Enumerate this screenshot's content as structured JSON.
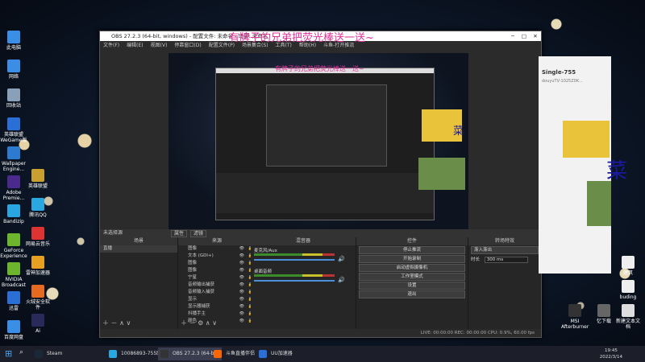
{
  "desktop_icons": [
    {
      "label": "此电脑",
      "color": "#3a8ee6"
    },
    {
      "label": "网络",
      "color": "#3a8ee6"
    },
    {
      "label": "回收站",
      "color": "#8aa0b8"
    },
    {
      "label": "英雄联盟 WeGame版",
      "color": "#2a6fd6"
    },
    {
      "label": "Wallpaper Engine...",
      "color": "#2c7bd1"
    },
    {
      "label": "Adobe Premie...",
      "color": "#4a2a8c"
    },
    {
      "label": "Bandizip",
      "color": "#2aa6e0"
    },
    {
      "label": "GeForce Experience",
      "color": "#6cb52d"
    },
    {
      "label": "NVIDIA Broadcast",
      "color": "#6cb52d"
    },
    {
      "label": "迅雷",
      "color": "#2a6fd6"
    },
    {
      "label": "百度网盘",
      "color": "#3a8ee6"
    }
  ],
  "desktop_icons_col2": [
    {
      "label": "英雄联盟",
      "color": "#c9a030"
    },
    {
      "label": "腾讯QQ",
      "color": "#2aa6e0"
    },
    {
      "label": "网易云音乐",
      "color": "#d33"
    },
    {
      "label": "雷神加速器",
      "color": "#e8a020"
    },
    {
      "label": "火绒安全软件",
      "color": "#e86a20"
    },
    {
      "label": "Ai",
      "color": "#2a2a5a"
    }
  ],
  "right_icons": [
    {
      "label": "MSI Afterburner",
      "color": "#333"
    },
    {
      "label": "忆下载",
      "color": "#666"
    },
    {
      "label": "新建文本文档",
      "color": "#ddd"
    },
    {
      "label": "建筑",
      "color": "#eee"
    },
    {
      "label": "buding",
      "color": "#eee"
    }
  ],
  "obs": {
    "title": "OBS 27.2.3 (64-bit, windows) - 配置文件: 未命名 - 场景: 未命名",
    "menu": [
      "文件(F)",
      "编辑(E)",
      "视图(V)",
      "停靠窗口(D)",
      "配置文件(P)",
      "场景集合(S)",
      "工具(T)",
      "帮助(H)",
      "斗鱼-打开推流"
    ],
    "overlay": "有牌子的兄弟把荧光棒送一送~",
    "scene_bar": "未选择源",
    "scene_bar_buttons": [
      "属性",
      "滤镜"
    ],
    "docks": {
      "scenes": {
        "title": "场景",
        "items": [
          "直播"
        ]
      },
      "sources": {
        "title": "来源",
        "items": [
          "图像",
          "文本 (GDI+)",
          "图像",
          "图像",
          "宁星",
          "音频输出捕获",
          "音频输入捕获",
          "显示",
          "显示器捕获",
          "抖播手主",
          "颜色"
        ]
      },
      "mixer": {
        "title": "混音器",
        "channels": [
          {
            "name": "麦克风/Aux"
          },
          {
            "name": "桌面音频"
          }
        ]
      },
      "controls": {
        "title": "控件",
        "buttons": [
          "停止推流",
          "开始录制",
          "启动虚拟摄像机",
          "工作室模式",
          "设置",
          "退出"
        ]
      },
      "transitions": {
        "title": "转场特效",
        "type": "渐入渐出",
        "duration_label": "时长",
        "duration": "300 ms"
      }
    },
    "status": "LIVE: 00:00:00    REC: 00:00:00    CPU: 0.9%, 60.00 fps"
  },
  "chat": {
    "title": "Single-755",
    "subtitle": "douyuTV-1025Z0K..."
  },
  "veg_text": "菜",
  "taskbar": {
    "items": [
      {
        "label": "Steam",
        "color": "#1b2838"
      },
      {
        "label": "10086893-755图...",
        "color": "#2aa6e0"
      },
      {
        "label": "OBS 27.2.3 (64-bit...",
        "color": "#333"
      },
      {
        "label": "斗鱼直播伴侣",
        "color": "#f60"
      },
      {
        "label": "UU加速器",
        "color": "#2a6fd6"
      }
    ],
    "time": "19:45",
    "date": "2022/3/14"
  }
}
